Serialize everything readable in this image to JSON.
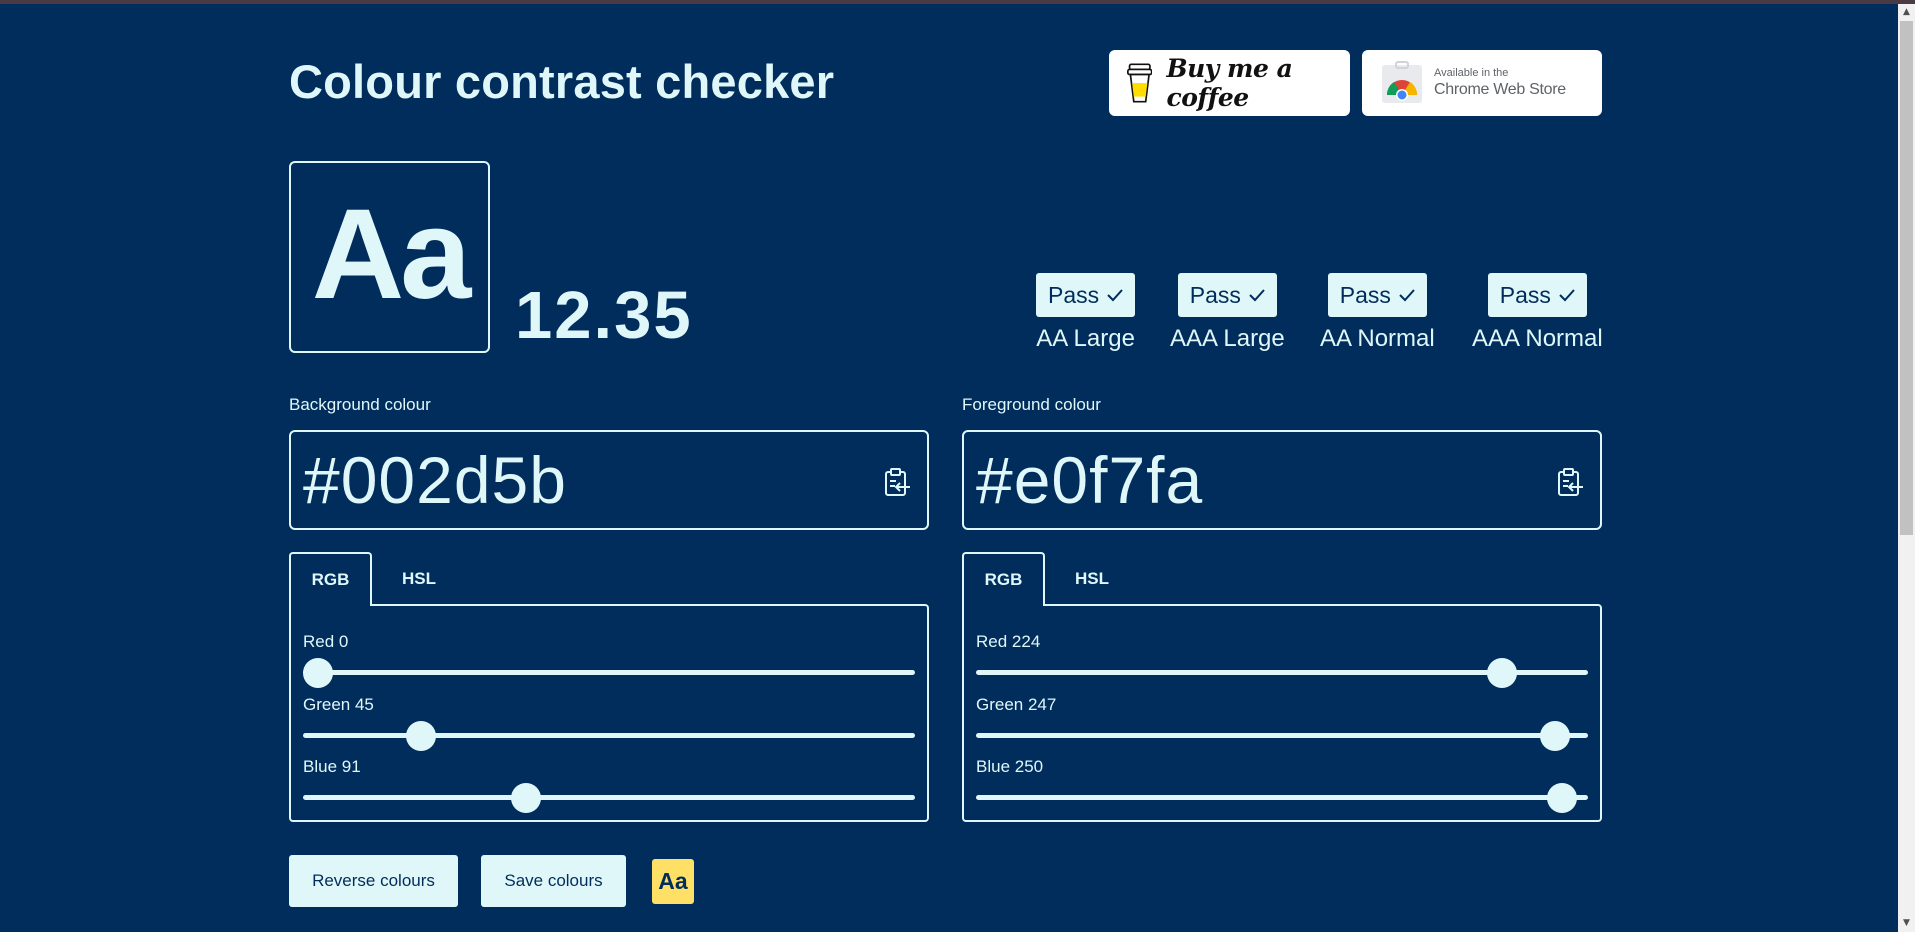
{
  "page": {
    "title": "Colour contrast checker",
    "colors": {
      "background": "#002d5b",
      "foreground": "#e0f7fa",
      "accent_chip": "#ffe066"
    }
  },
  "badges": {
    "coffee": {
      "text": "Buy me a coffee",
      "icon": "coffee-cup-icon"
    },
    "chrome": {
      "small": "Available in the",
      "big": "Chrome Web Store",
      "icon": "chrome-logo-icon"
    }
  },
  "preview": {
    "sample": "Aa",
    "ratio": "12.35"
  },
  "tests": [
    {
      "result": "Pass",
      "label": "AA Large"
    },
    {
      "result": "Pass",
      "label": "AAA Large"
    },
    {
      "result": "Pass",
      "label": "AA Normal"
    },
    {
      "result": "Pass",
      "label": "AAA Normal"
    }
  ],
  "background": {
    "label": "Background colour",
    "hex": "#002d5b",
    "tabs": [
      "RGB",
      "HSL"
    ],
    "active_tab": "RGB",
    "sliders": [
      {
        "label": "Red 0",
        "value": 0,
        "max": 255
      },
      {
        "label": "Green 45",
        "value": 45,
        "max": 255
      },
      {
        "label": "Blue 91",
        "value": 91,
        "max": 255
      }
    ]
  },
  "foreground": {
    "label": "Foreground colour",
    "hex": "#e0f7fa",
    "tabs": [
      "RGB",
      "HSL"
    ],
    "active_tab": "RGB",
    "sliders": [
      {
        "label": "Red 224",
        "value": 224,
        "max": 255
      },
      {
        "label": "Green 247",
        "value": 247,
        "max": 255
      },
      {
        "label": "Blue 250",
        "value": 250,
        "max": 255
      }
    ]
  },
  "actions": {
    "reverse": "Reverse colours",
    "save": "Save colours",
    "chip": "Aa"
  }
}
